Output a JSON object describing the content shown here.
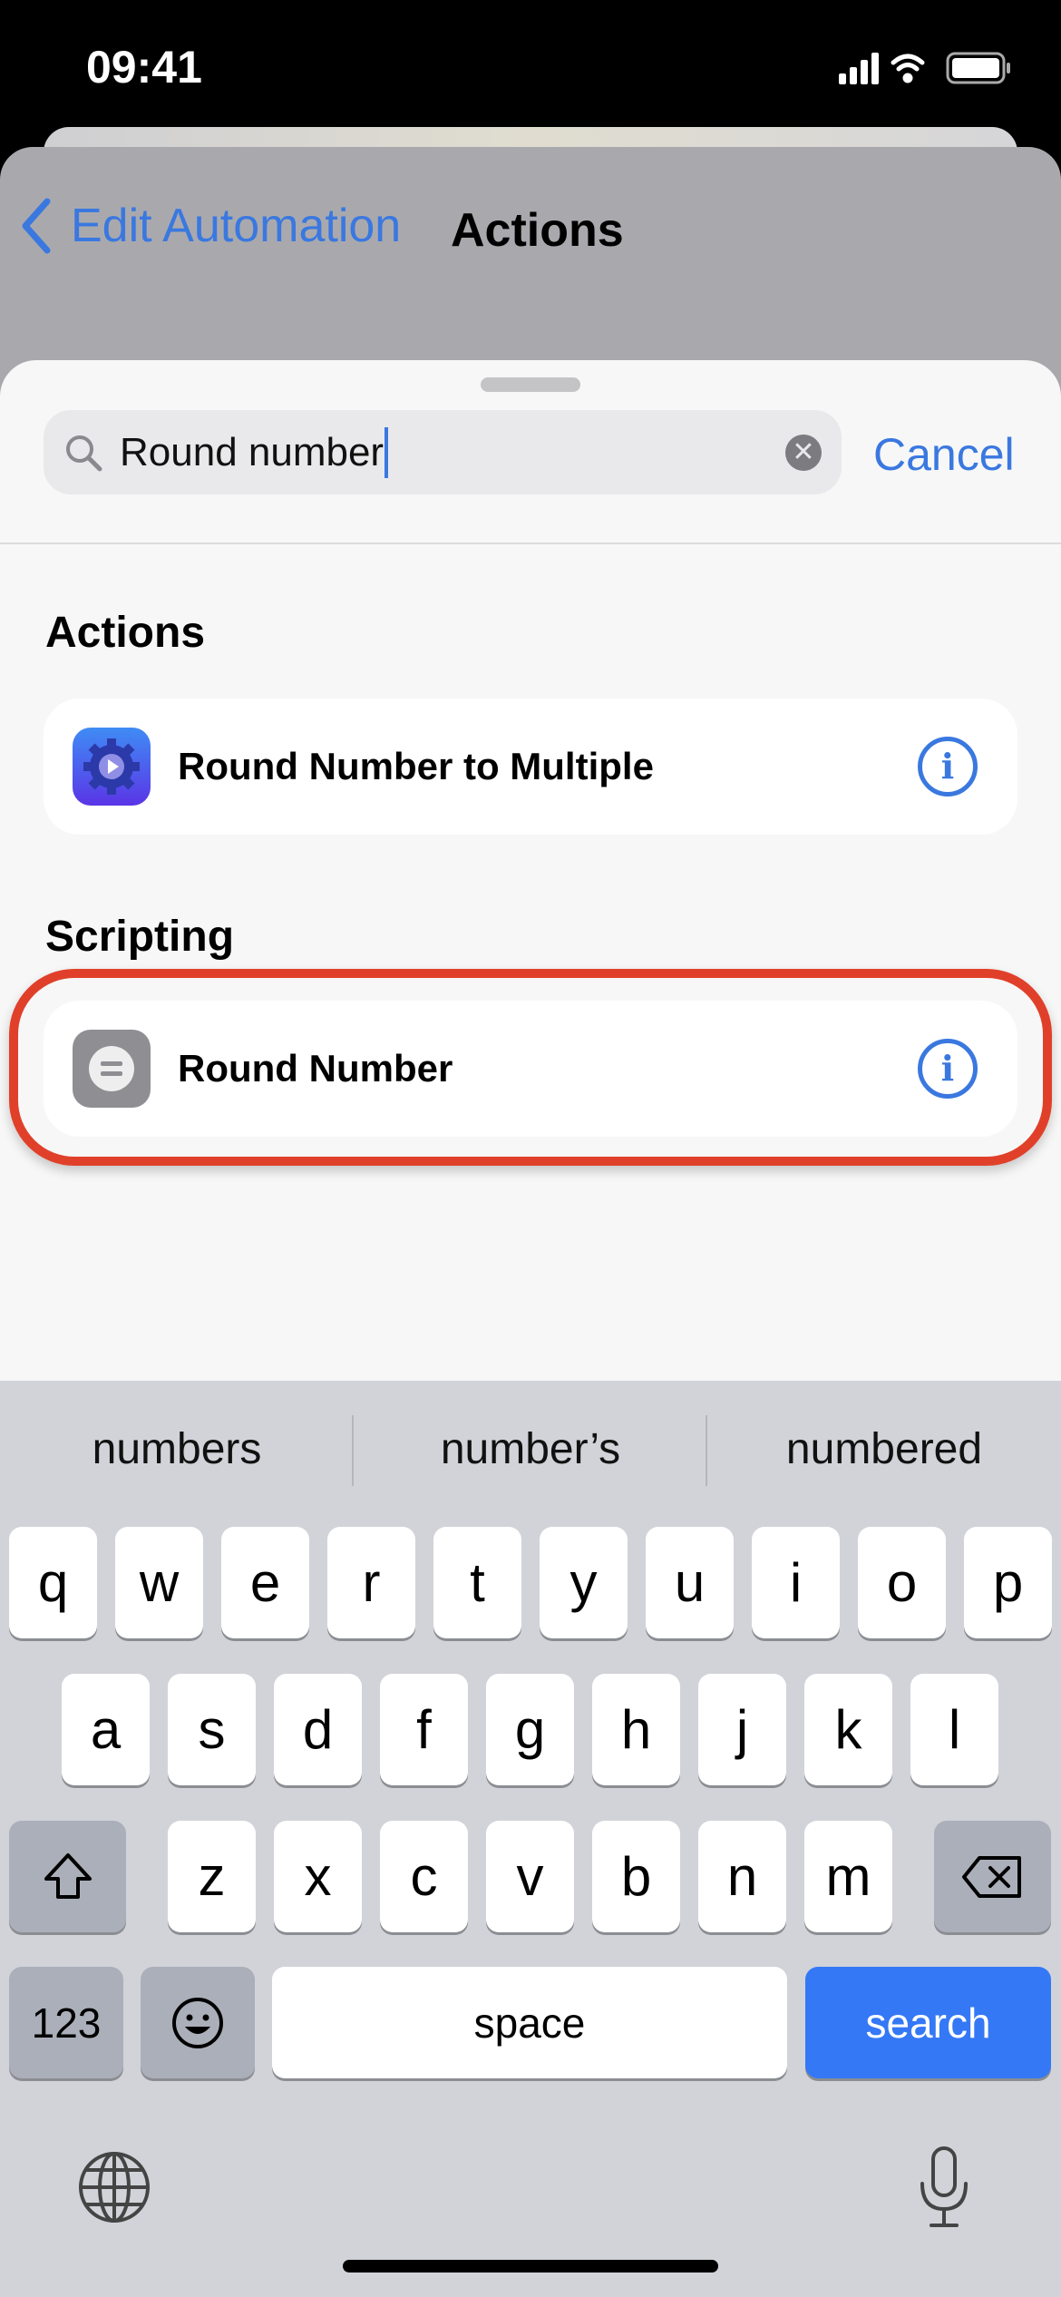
{
  "status_bar": {
    "time": "09:41"
  },
  "nav": {
    "back_label": "Edit Automation",
    "title": "Actions"
  },
  "search": {
    "value": "Round number",
    "cancel_label": "Cancel"
  },
  "sections": [
    {
      "header": "Actions",
      "items": [
        {
          "label": "Round Number to Multiple",
          "icon": "gear-play-icon"
        }
      ]
    },
    {
      "header": "Scripting",
      "items": [
        {
          "label": "Round Number",
          "icon": "equals-icon"
        }
      ]
    }
  ],
  "keyboard": {
    "suggestions": [
      "numbers",
      "number’s",
      "numbered"
    ],
    "row1": [
      "q",
      "w",
      "e",
      "r",
      "t",
      "y",
      "u",
      "i",
      "o",
      "p"
    ],
    "row2": [
      "a",
      "s",
      "d",
      "f",
      "g",
      "h",
      "j",
      "k",
      "l"
    ],
    "row3": [
      "z",
      "x",
      "c",
      "v",
      "b",
      "n",
      "m"
    ],
    "numbers_label": "123",
    "space_label": "space",
    "search_label": "search"
  },
  "colors": {
    "accent": "#3a78e0",
    "highlight": "#e0402a",
    "search_key": "#3478f6"
  }
}
